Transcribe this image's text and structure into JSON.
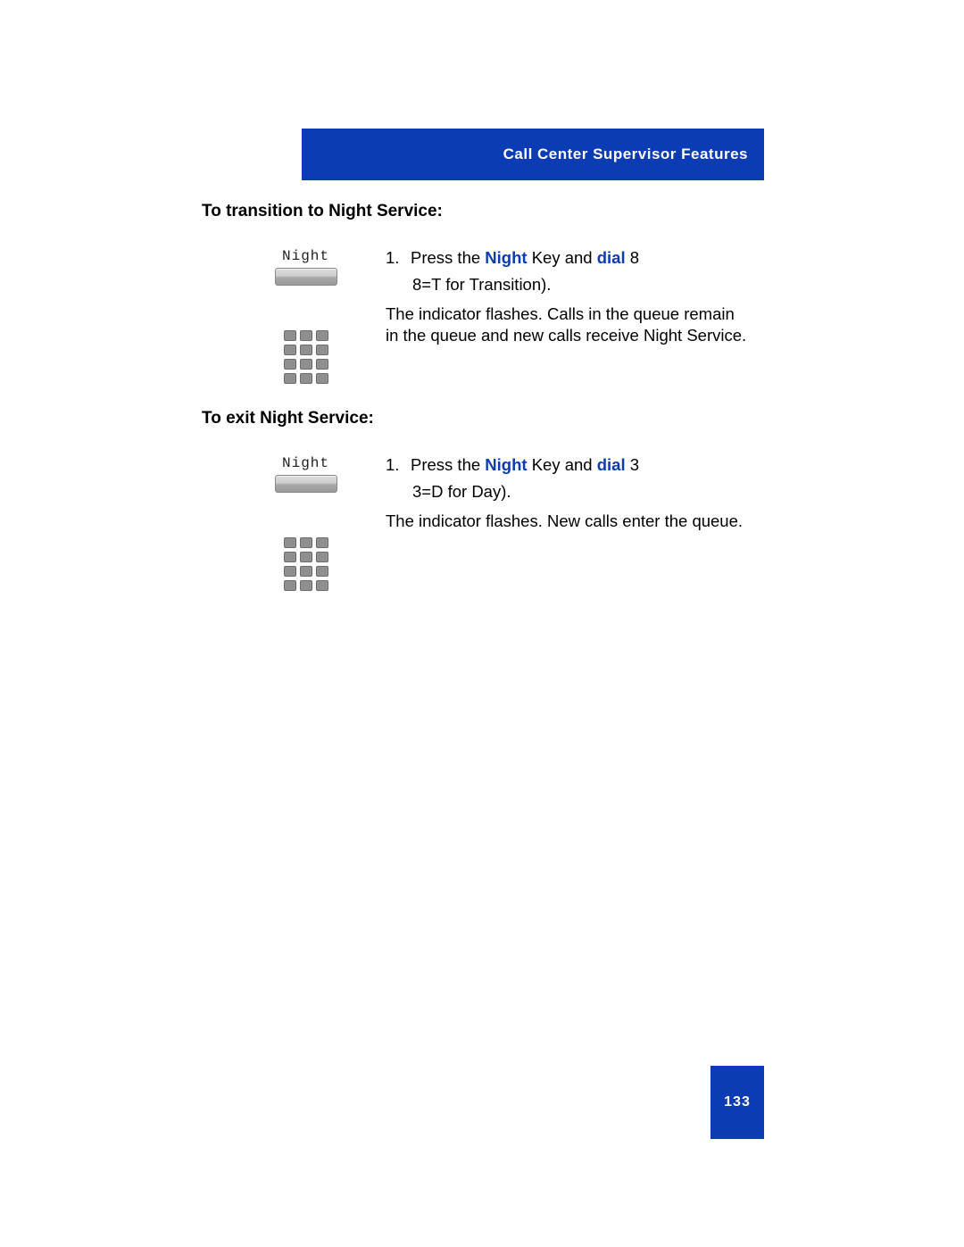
{
  "header": {
    "title": "Call Center Supervisor Features"
  },
  "section1": {
    "heading": "To transition to Night Service:",
    "key_label": "Night",
    "step_num": "1.",
    "press": "Press the ",
    "night": "Night",
    "key_and": " Key and ",
    "dial": "dial",
    "after_dial": " 8",
    "sub": "8=T for Transition).",
    "desc": "The indicator flashes. Calls in the queue remain in the queue and new calls receive Night Service."
  },
  "section2": {
    "heading": "To exit Night Service:",
    "key_label": "Night",
    "step_num": "1.",
    "press": "Press the ",
    "night": "Night",
    "key_and": " Key and ",
    "dial": "dial",
    "after_dial": " 3",
    "sub": "3=D for Day).",
    "desc": "The indicator flashes. New calls enter the queue."
  },
  "page_number": "133"
}
